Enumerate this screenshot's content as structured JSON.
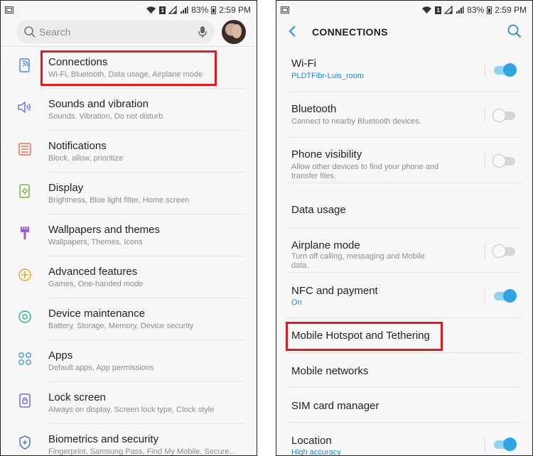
{
  "status_bar": {
    "battery": "83%",
    "time": "2:59 PM",
    "sim": "1"
  },
  "left_screen": {
    "search_placeholder": "Search",
    "items": [
      {
        "title": "Connections",
        "subtitle": "Wi-Fi, Bluetooth, Data usage, Airplane mode",
        "icon": "connections-icon",
        "color": "#4a8fd1"
      },
      {
        "title": "Sounds and vibration",
        "subtitle": "Sounds, Vibration, Do not disturb",
        "icon": "speaker-icon",
        "color": "#5b7fd6"
      },
      {
        "title": "Notifications",
        "subtitle": "Block, allow, prioritize",
        "icon": "notifications-icon",
        "color": "#e8704d"
      },
      {
        "title": "Display",
        "subtitle": "Brightness, Blue light filter, Home screen",
        "icon": "display-icon",
        "color": "#7cb342"
      },
      {
        "title": "Wallpapers and themes",
        "subtitle": "Wallpapers, Themes, Icons",
        "icon": "brush-icon",
        "color": "#9c5bd6"
      },
      {
        "title": "Advanced features",
        "subtitle": "Games, One-handed mode",
        "icon": "advanced-features-icon",
        "color": "#e3a82b"
      },
      {
        "title": "Device maintenance",
        "subtitle": "Battery, Storage, Memory, Device security",
        "icon": "maintenance-icon",
        "color": "#2bb39a"
      },
      {
        "title": "Apps",
        "subtitle": "Default apps, App permissions",
        "icon": "apps-icon",
        "color": "#3e9ad6"
      },
      {
        "title": "Lock screen",
        "subtitle": "Always on display, Screen lock type, Clock style",
        "icon": "lock-icon",
        "color": "#6d6dd1"
      },
      {
        "title": "Biometrics and security",
        "subtitle": "Fingerprint, Samsung Pass, Find My Mobile, Secure...",
        "icon": "shield-icon",
        "color": "#5577aa"
      }
    ]
  },
  "right_screen": {
    "title": "CONNECTIONS",
    "items": [
      {
        "title": "Wi-Fi",
        "subtitle": "PLDTFibr-Luis_room",
        "subtitle_accent": true,
        "toggle": "on"
      },
      {
        "title": "Bluetooth",
        "subtitle": "Connect to nearby Bluetooth devices.",
        "toggle": "off"
      },
      {
        "title": "Phone visibility",
        "subtitle": "Allow other devices to find your phone and transfer files.",
        "toggle": "off"
      },
      {
        "title": "Data usage",
        "subtitle": "",
        "toggle": "none"
      },
      {
        "title": "Airplane mode",
        "subtitle": "Turn off calling, messaging and Mobile data.",
        "toggle": "off"
      },
      {
        "title": "NFC and payment",
        "subtitle": "On",
        "subtitle_accent": true,
        "toggle": "on"
      },
      {
        "title": "Mobile Hotspot and Tethering",
        "subtitle": "",
        "toggle": "none"
      },
      {
        "title": "Mobile networks",
        "subtitle": "",
        "toggle": "none"
      },
      {
        "title": "SIM card manager",
        "subtitle": "",
        "toggle": "none"
      },
      {
        "title": "Location",
        "subtitle": "High accuracy",
        "subtitle_accent": true,
        "toggle": "on"
      }
    ]
  },
  "colors": {
    "highlight": "#e11b22",
    "accent": "#1a8bd6",
    "toggle_on": "#2ea5e1"
  }
}
